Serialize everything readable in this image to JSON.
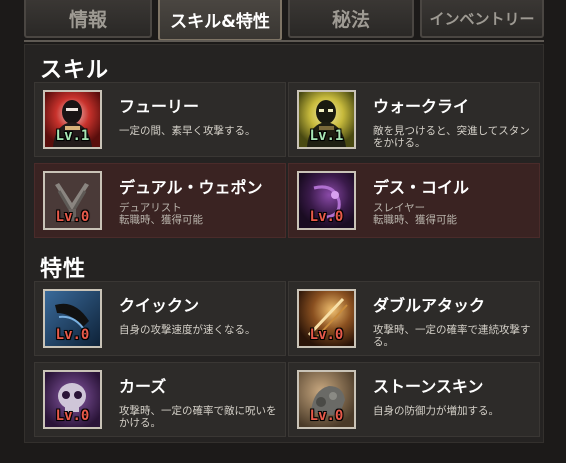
{
  "tabs": [
    {
      "label": "情報",
      "active": false
    },
    {
      "label": "スキル&特性",
      "active": true
    },
    {
      "label": "秘法",
      "active": false
    },
    {
      "label": "インベントリー",
      "active": false
    }
  ],
  "skills_section": {
    "title": "スキル",
    "items": [
      {
        "name": "フューリー",
        "level": "Lv.1",
        "desc": "一定の間、素早く攻撃する。",
        "icon": "fury-icon"
      },
      {
        "name": "ウォークライ",
        "level": "Lv.1",
        "desc": "敵を見つけると、突進してスタンをかける。",
        "icon": "warcry-icon"
      },
      {
        "name": "デュアル・ウェポン",
        "level": "Lv.0",
        "desc_line1": "デュアリスト",
        "desc_line2": "転職時、獲得可能",
        "icon": "dual-weapon-icon"
      },
      {
        "name": "デス・コイル",
        "level": "Lv.0",
        "desc_line1": "スレイヤー",
        "desc_line2": "転職時、獲得可能",
        "icon": "death-coil-icon"
      }
    ]
  },
  "traits_section": {
    "title": "特性",
    "items": [
      {
        "name": "クイックン",
        "level": "Lv.0",
        "desc": "自身の攻撃速度が速くなる。",
        "icon": "quicken-icon"
      },
      {
        "name": "ダブルアタック",
        "level": "Lv.0",
        "desc": "攻撃時、一定の確率で連続攻撃する。",
        "icon": "double-attack-icon"
      },
      {
        "name": "カーズ",
        "level": "Lv.0",
        "desc": "攻撃時、一定の確率で敵に呪いをかける。",
        "icon": "curse-icon"
      },
      {
        "name": "ストーンスキン",
        "level": "Lv.0",
        "desc": "自身の防御力が増加する。",
        "icon": "stoneskin-icon"
      }
    ]
  },
  "colors": {
    "level_unlocked": "#a7e6b4",
    "level_locked": "#e85a4a",
    "locked_card_bg": "#3a2322"
  }
}
